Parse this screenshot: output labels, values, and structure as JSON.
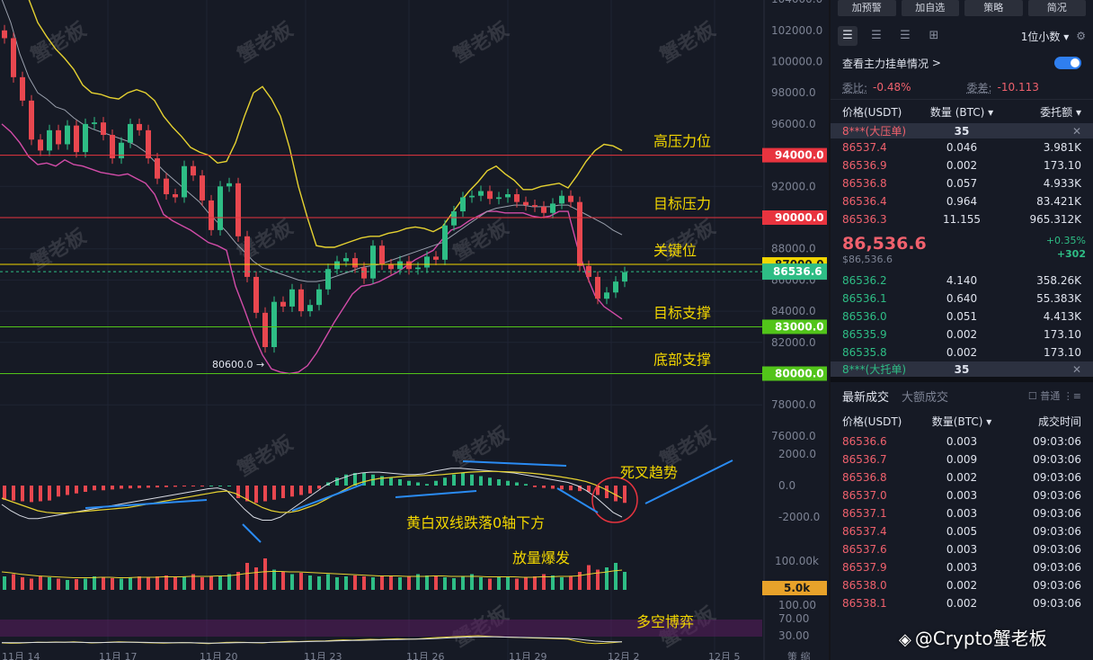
{
  "chart_data": {
    "type": "line",
    "price_ticks": [
      "104000.0",
      "102000.0",
      "100000.0",
      "98000.0",
      "96000.0",
      "94000.0",
      "92000.0",
      "90000.0",
      "88000.0",
      "87000.0",
      "86000.0",
      "84000.0",
      "82000.0",
      "80000.0",
      "78000.0",
      "76000.0"
    ],
    "macd_ticks": [
      "2000.0",
      "0.0",
      "-2000.0"
    ],
    "volume_ticks": [
      "100.00k",
      "5.0k"
    ],
    "rsi_ticks": [
      "100.00",
      "70.00",
      "30.00"
    ],
    "x_ticks": [
      "11月 14",
      "11月 17",
      "11月 20",
      "11月 23",
      "11月 26",
      "11月 29",
      "12月 2",
      "12月 5"
    ],
    "corner_label": "策 缩",
    "current_price": "86536.6",
    "low_label": "80600.0 →",
    "levels": [
      {
        "price": 94000,
        "tag": "94000.0",
        "note": "高压力位",
        "color": "#e8343f"
      },
      {
        "price": 90000,
        "tag": "90000.0",
        "note": "目标压力",
        "color": "#e8343f"
      },
      {
        "price": 87000,
        "tag": "87000.0",
        "note": "关键位",
        "color": "#f2d600"
      },
      {
        "price": 83000,
        "tag": "83000.0",
        "note": "目标支撑",
        "color": "#52c41a"
      },
      {
        "price": 80000,
        "tag": "80000.0",
        "note": "底部支撑",
        "color": "#52c41a"
      }
    ],
    "annotations": [
      "死叉趋势",
      "黄白双线跌落0轴下方",
      "放量爆发",
      "多空博弈"
    ],
    "watermark": "蟹老板",
    "price_series": {
      "x": [
        0,
        10,
        20,
        30,
        40,
        50,
        60,
        70,
        80,
        90,
        100,
        110,
        120,
        130,
        140,
        150,
        160,
        170,
        180,
        190,
        200,
        210,
        220,
        230,
        240,
        250,
        260,
        270,
        280,
        290,
        300,
        310,
        320,
        330,
        340,
        350,
        360,
        370,
        380,
        390,
        400,
        410,
        420,
        430,
        440,
        450,
        460,
        470,
        480,
        490,
        500,
        510,
        520,
        530,
        540,
        550,
        560,
        570,
        580,
        590,
        600,
        610,
        620,
        630,
        640,
        650,
        660,
        670,
        680,
        690
      ],
      "close": [
        101500,
        99000,
        97500,
        95000,
        94300,
        95600,
        94700,
        95900,
        94200,
        96000,
        96100,
        95300,
        93800,
        94800,
        96000,
        95600,
        93800,
        92500,
        91500,
        91300,
        93300,
        92700,
        91100,
        89200,
        92000,
        92200,
        88800,
        86200,
        83900,
        81700,
        84600,
        84300,
        85400,
        84000,
        84400,
        85400,
        86700,
        87200,
        87400,
        86800,
        86100,
        88200,
        87000,
        86700,
        87200,
        86700,
        86800,
        87500,
        87300,
        89500,
        90400,
        91300,
        91400,
        91700,
        91200,
        91300,
        91500,
        91000,
        90800,
        90700,
        90300,
        90900,
        91400,
        91000,
        86900,
        86200,
        84800,
        85200,
        85900,
        86500
      ]
    },
    "upper_band": [
      113000,
      110000,
      106000,
      104000,
      102500,
      101600,
      100800,
      100200,
      99500,
      98500,
      98000,
      97900,
      97700,
      97600,
      98000,
      98200,
      98000,
      97500,
      96500,
      95800,
      95200,
      94500,
      94200,
      94000,
      93500,
      93600,
      94800,
      96500,
      98000,
      98400,
      97600,
      96500,
      94500,
      92000,
      90000,
      88200,
      88100,
      88100,
      88300,
      88500,
      88700,
      88800,
      88800,
      89000,
      89100,
      89300,
      89400,
      89300,
      89100,
      89400,
      90200,
      91000,
      91700,
      92300,
      93000,
      93300,
      92800,
      92400,
      91800,
      91800,
      92000,
      92100,
      92200,
      91900,
      92700,
      93600,
      94300,
      94700,
      94600,
      94300
    ],
    "lower_band": [
      96000,
      95500,
      94800,
      93900,
      93400,
      93500,
      93300,
      93700,
      93400,
      93300,
      93100,
      92900,
      92800,
      92700,
      92800,
      92500,
      92200,
      91500,
      90200,
      89800,
      89500,
      89200,
      88800,
      88400,
      88200,
      87900,
      85600,
      84100,
      82500,
      81200,
      80300,
      80100,
      80000,
      80100,
      80500,
      81300,
      82300,
      83300,
      84200,
      85100,
      85600,
      85700,
      85900,
      86200,
      86500,
      86900,
      87300,
      87600,
      87900,
      88600,
      89200,
      89400,
      89800,
      90100,
      90400,
      90400,
      90300,
      90300,
      90300,
      90100,
      90000,
      90100,
      90400,
      90400,
      88200,
      86400,
      85000,
      84300,
      83900,
      83500
    ],
    "mid_band": [
      104000,
      102500,
      100500,
      99000,
      98000,
      97600,
      97100,
      96900,
      96400,
      96000,
      95700,
      95500,
      95300,
      95100,
      94900,
      94600,
      94200,
      93600,
      93000,
      92500,
      92000,
      91500,
      91000,
      90300,
      89700,
      89100,
      88400,
      87800,
      87200,
      86800,
      86600,
      86400,
      86200,
      86000,
      85900,
      85900,
      86000,
      86200,
      86400,
      86600,
      86800,
      86900,
      87000,
      87200,
      87400,
      87600,
      87800,
      88000,
      88200,
      88400,
      88800,
      89200,
      89600,
      90000,
      90400,
      90600,
      90700,
      90800,
      90800,
      90700,
      90700,
      90700,
      90800,
      90800,
      90500,
      90200,
      89900,
      89600,
      89200,
      88900
    ],
    "macd_hist": [
      -900,
      -950,
      -1000,
      -1050,
      -1000,
      -950,
      -700,
      -600,
      -500,
      -400,
      -300,
      -300,
      -250,
      -200,
      -180,
      -160,
      -140,
      -120,
      -100,
      -80,
      -60,
      -40,
      -20,
      0,
      0,
      0,
      -800,
      -1000,
      -1100,
      -1000,
      -900,
      -800,
      -700,
      -600,
      -500,
      -200,
      200,
      500,
      700,
      800,
      800,
      700,
      600,
      500,
      400,
      300,
      200,
      100,
      300,
      500,
      700,
      800,
      700,
      600,
      500,
      400,
      300,
      200,
      100,
      -100,
      -150,
      -200,
      -250,
      -300,
      -350,
      -400,
      -600,
      -800,
      -1000,
      -1100
    ],
    "dif_line": [
      -1200,
      -1600,
      -1900,
      -2100,
      -2100,
      -2000,
      -1900,
      -1800,
      -1700,
      -1600,
      -1500,
      -1400,
      -1300,
      -1200,
      -1100,
      -1000,
      -900,
      -800,
      -700,
      -600,
      -500,
      -400,
      -300,
      -200,
      -150,
      -300,
      -900,
      -1500,
      -2000,
      -2200,
      -2200,
      -2000,
      -1600,
      -1200,
      -800,
      -400,
      0,
      300,
      500,
      700,
      800,
      850,
      850,
      800,
      750,
      700,
      700,
      750,
      900,
      1000,
      1100,
      1100,
      1050,
      1000,
      950,
      900,
      850,
      800,
      700,
      600,
      500,
      400,
      300,
      200,
      0,
      -300,
      -700,
      -1200,
      -1700,
      -2000
    ],
    "dea_line": [
      -800,
      -1000,
      -1200,
      -1400,
      -1600,
      -1700,
      -1750,
      -1750,
      -1700,
      -1650,
      -1600,
      -1550,
      -1500,
      -1450,
      -1400,
      -1300,
      -1200,
      -1100,
      -1000,
      -900,
      -800,
      -700,
      -600,
      -500,
      -400,
      -350,
      -500,
      -800,
      -1100,
      -1400,
      -1600,
      -1700,
      -1700,
      -1600,
      -1400,
      -1200,
      -900,
      -600,
      -300,
      0,
      200,
      350,
      450,
      500,
      550,
      600,
      620,
      640,
      660,
      700,
      750,
      800,
      850,
      880,
      900,
      900,
      880,
      860,
      830,
      780,
      720,
      650,
      570,
      480,
      380,
      250,
      50,
      -200,
      -500,
      -800
    ],
    "volume": [
      30,
      35,
      28,
      25,
      30,
      28,
      25,
      22,
      24,
      25,
      30,
      28,
      26,
      25,
      28,
      30,
      28,
      30,
      32,
      28,
      30,
      35,
      28,
      30,
      32,
      35,
      40,
      60,
      50,
      70,
      45,
      40,
      35,
      38,
      32,
      30,
      35,
      28,
      30,
      32,
      30,
      28,
      30,
      32,
      28,
      30,
      35,
      32,
      30,
      28,
      26,
      30,
      35,
      28,
      25,
      30,
      28,
      25,
      28,
      30,
      35,
      32,
      28,
      30,
      40,
      55,
      45,
      50,
      60,
      40
    ],
    "volume_avg": [
      40,
      38,
      35,
      33,
      31,
      30,
      29,
      28,
      27,
      27,
      27,
      28,
      28,
      27,
      27,
      28,
      28,
      28,
      29,
      29,
      29,
      30,
      30,
      30,
      31,
      31,
      33,
      36,
      38,
      40,
      41,
      41,
      40,
      40,
      39,
      38,
      37,
      36,
      35,
      34,
      33,
      32,
      31,
      31,
      31,
      30,
      30,
      30,
      31,
      31,
      30,
      30,
      30,
      30,
      29,
      29,
      29,
      29,
      28,
      28,
      29,
      29,
      30,
      30,
      31,
      34,
      37,
      39,
      42,
      44
    ],
    "rsi": [
      30,
      28,
      29,
      32,
      34,
      33,
      35,
      34,
      36,
      33,
      30,
      32,
      34,
      36,
      35,
      33,
      31,
      30,
      29,
      30,
      32,
      31,
      28,
      26,
      30,
      33,
      34,
      33,
      31,
      30,
      34,
      36,
      38,
      37,
      39,
      40,
      41,
      44,
      46,
      45,
      47,
      49,
      48,
      50,
      52,
      51,
      50,
      54,
      57,
      60,
      62,
      64,
      66,
      68,
      65,
      63,
      61,
      60,
      58,
      56,
      55,
      54,
      52,
      50,
      38,
      30,
      26,
      28,
      32,
      36
    ],
    "rsi2": [
      32,
      31,
      31,
      32,
      33,
      33,
      34,
      34,
      34,
      33,
      32,
      32,
      33,
      34,
      34,
      34,
      33,
      32,
      31,
      31,
      31,
      31,
      30,
      29,
      29,
      30,
      31,
      32,
      32,
      32,
      33,
      34,
      35,
      36,
      37,
      38,
      39,
      41,
      42,
      43,
      44,
      45,
      46,
      47,
      48,
      49,
      50,
      51,
      53,
      55,
      57,
      59,
      61,
      62,
      62,
      62,
      61,
      60,
      59,
      58,
      57,
      56,
      55,
      54,
      50,
      45,
      40,
      37,
      36,
      36
    ]
  },
  "panel": {
    "buttons": [
      "加预警",
      "加自选",
      "策略",
      "简况"
    ],
    "decimal": "1位小数",
    "settings_icon": "gear-icon",
    "view_orders": "查看主力挂单情况",
    "ratio_label": "委比:",
    "ratio_value": "-0.48%",
    "diff_label": "委差:",
    "diff_value": "-10.113",
    "columns": [
      "价格(USDT)",
      "数量 (BTC) ▾",
      "委托额 ▾"
    ],
    "big_ask": {
      "label": "8***(大压单)",
      "qty": "35",
      "close": "✕"
    },
    "asks": [
      [
        "86537.4",
        "0.046",
        "3.981K"
      ],
      [
        "86536.9",
        "0.002",
        "173.10"
      ],
      [
        "86536.8",
        "0.057",
        "4.933K"
      ],
      [
        "86536.4",
        "0.964",
        "83.421K"
      ],
      [
        "86536.3",
        "11.155",
        "965.312K"
      ]
    ],
    "last_price": "86,536.6",
    "last_price_usd": "$86,536.6",
    "change_pct": "+0.35%",
    "change_abs": "+302",
    "bids": [
      [
        "86536.2",
        "4.140",
        "358.26K"
      ],
      [
        "86536.1",
        "0.640",
        "55.383K"
      ],
      [
        "86536.0",
        "0.051",
        "4.413K"
      ],
      [
        "86535.9",
        "0.002",
        "173.10"
      ],
      [
        "86535.8",
        "0.002",
        "173.10"
      ]
    ],
    "big_bid": {
      "label": "8***(大托单)",
      "qty": "35",
      "close": "✕"
    },
    "tab_latest": "最新成交",
    "tab_large": "大额成交",
    "normal_label": "普通",
    "trade_columns": [
      "价格(USDT)",
      "数量(BTC) ▾",
      "成交时间"
    ],
    "trades": [
      [
        "86536.6",
        "0.003",
        "09:03:06"
      ],
      [
        "86536.7",
        "0.009",
        "09:03:06"
      ],
      [
        "86536.8",
        "0.002",
        "09:03:06"
      ],
      [
        "86537.0",
        "0.003",
        "09:03:06"
      ],
      [
        "86537.1",
        "0.003",
        "09:03:06"
      ],
      [
        "86537.4",
        "0.005",
        "09:03:06"
      ],
      [
        "86537.6",
        "0.003",
        "09:03:06"
      ],
      [
        "86537.9",
        "0.003",
        "09:03:06"
      ],
      [
        "86538.0",
        "0.002",
        "09:03:06"
      ],
      [
        "86538.1",
        "0.002",
        "09:03:06"
      ]
    ],
    "credit": "@Crypto蟹老板"
  }
}
